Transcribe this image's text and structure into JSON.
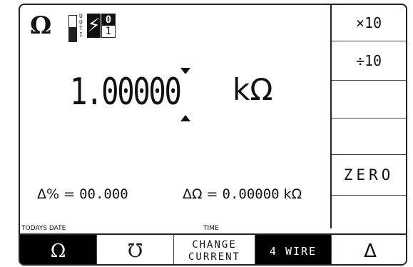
{
  "status": {
    "function_symbol": "Ω",
    "uut_label_lines": [
      "U",
      "U",
      "T",
      "I"
    ],
    "uut_level_fraction": 0.55,
    "hv_symbol": "⚡",
    "range_top": "0",
    "range_bottom": "1"
  },
  "display": {
    "reading": "1.00000",
    "unit": "kΩ"
  },
  "deviations": {
    "percent_label": "Δ% =",
    "percent_value": "00.000",
    "ohm_label": "ΔΩ =",
    "ohm_value": "0.00000",
    "ohm_unit": "kΩ"
  },
  "captions": {
    "date": "TODAYS DATE",
    "time": "TIME"
  },
  "softkeys": {
    "mult": "×10",
    "div": "÷10",
    "blank1": "",
    "blank2": "",
    "zero": "ZERO",
    "blank3": ""
  },
  "fkeys": {
    "ohm": "Ω",
    "mho": "℧",
    "change_1": "CHANGE",
    "change_2": "CURRENT",
    "four_wire": "4 WIRE",
    "delta": "Δ"
  }
}
